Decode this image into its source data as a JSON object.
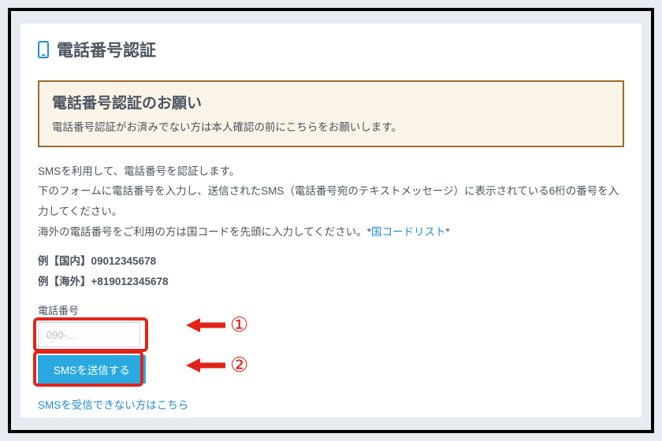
{
  "title": "電話番号認証",
  "notice": {
    "title": "電話番号認証のお願い",
    "body": "電話番号認証がお済みでない方は本人確認の前にこちらをお願いします。"
  },
  "desc": {
    "line1": "SMSを利用して、電話番号を認証します。",
    "line2": "下のフォームに電話番号を入力し、送信されたSMS（電話番号宛のテキストメッセージ）に表示されている6桁の番号を入力してください。",
    "line3_pre": "海外の電話番号をご利用の方は国コードを先頭に入力してください。*",
    "line3_link": "国コードリスト",
    "line3_post": "*"
  },
  "examples": {
    "domestic": "例【国内】09012345678",
    "intl": "例【海外】+819012345678"
  },
  "field": {
    "label": "電話番号",
    "placeholder": "090-..."
  },
  "button": {
    "send": "SMSを送信する"
  },
  "fallback_link": "SMSを受信できない方はこちら",
  "annotations": {
    "a1": "①",
    "a2": "②"
  }
}
